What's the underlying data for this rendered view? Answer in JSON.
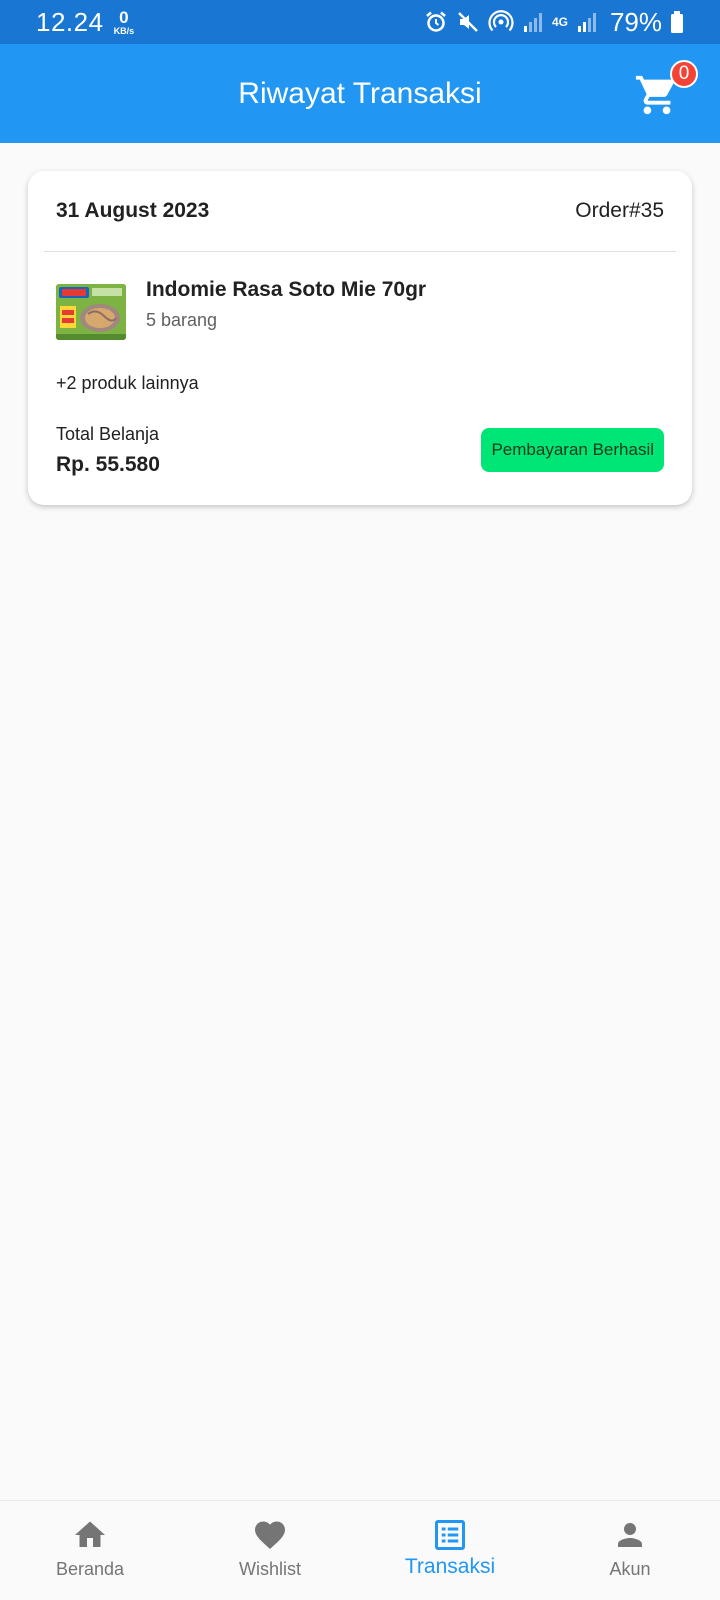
{
  "status_bar": {
    "time": "12.24",
    "speed_value": "0",
    "speed_unit": "KB/s",
    "network_label": "4G",
    "battery": "79%",
    "icons": [
      "alarm-icon",
      "mute-icon",
      "hotspot-icon",
      "signal-icon",
      "signal-icon",
      "battery-icon"
    ]
  },
  "app_bar": {
    "title": "Riwayat Transaksi",
    "cart_badge": "0",
    "cart_icon": "shopping-cart-icon"
  },
  "transactions": [
    {
      "date": "31 August 2023",
      "order_number": "Order#35",
      "product_name": "Indomie Rasa Soto Mie 70gr",
      "product_quantity": "5 barang",
      "more_products": "+2 produk lainnya",
      "total_label": "Total Belanja",
      "total_value": "Rp. 55.580",
      "status": "Pembayaran Berhasil",
      "status_color": "#00e676"
    }
  ],
  "bottom_nav": {
    "items": [
      {
        "label": "Beranda",
        "icon": "home-icon"
      },
      {
        "label": "Wishlist",
        "icon": "heart-icon"
      },
      {
        "label": "Transaksi",
        "icon": "receipt-list-icon"
      },
      {
        "label": "Akun",
        "icon": "person-icon"
      }
    ],
    "active_index": 2,
    "active_color": "#2196f3",
    "inactive_color": "#757575"
  },
  "colors": {
    "status_bar": "#1976d2",
    "app_bar": "#2196f3",
    "badge": "#f44336",
    "background": "#fafafa"
  }
}
